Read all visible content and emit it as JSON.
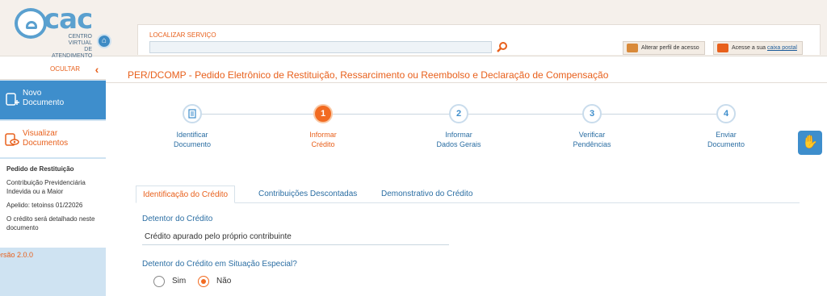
{
  "brand": {
    "name": "cac",
    "subtitle_line1": "CENTRO VIRTUAL",
    "subtitle_line2": "DE ATENDIMENTO"
  },
  "search": {
    "label": "LOCALIZAR SERVIÇO",
    "placeholder": "",
    "value": ""
  },
  "header_actions": {
    "alterar_perfil": "Alterar perfil de acesso",
    "acesse_prefix": "Acesse a sua ",
    "acesse_link": "caixa postal"
  },
  "sidebar": {
    "ocultar": "OCULTAR",
    "novo_line1": "Novo",
    "novo_line2": "Documento",
    "visualizar_line1": "Visualizar",
    "visualizar_line2": "Documentos",
    "info_title": "Pedido de Restituição",
    "info_desc": "Contribuição Previdenciária Indevida ou a Maior",
    "info_apelido": "Apelido: tetoinss 01/22026",
    "info_note": "O crédito será detalhado neste documento",
    "versao": "ersão 2.0.0"
  },
  "main": {
    "title": "PER/DCOMP - Pedido Eletrônico de Restituição, Ressarcimento ou Reembolso e Declaração de Compensação"
  },
  "steps": [
    {
      "number": "",
      "icon": "document-icon",
      "line1": "Identificar",
      "line2": "Documento",
      "active": false
    },
    {
      "number": "1",
      "line1": "Informar",
      "line2": "Crédito",
      "active": true
    },
    {
      "number": "2",
      "line1": "Informar",
      "line2": "Dados Gerais",
      "active": false
    },
    {
      "number": "3",
      "line1": "Verificar",
      "line2": "Pendências",
      "active": false
    },
    {
      "number": "4",
      "line1": "Enviar",
      "line2": "Documento",
      "active": false
    }
  ],
  "tabs": [
    {
      "label": "Identificação do Crédito",
      "active": true
    },
    {
      "label": "Contribuições Descontadas",
      "active": false
    },
    {
      "label": "Demonstrativo do Crédito",
      "active": false
    }
  ],
  "form": {
    "detentor_label": "Detentor do Crédito",
    "detentor_value": "Crédito apurado pelo próprio contribuinte",
    "situacao_label": "Detentor do Crédito em Situação Especial?",
    "option_sim": "Sim",
    "option_nao": "Não",
    "selected": "Não"
  },
  "colors": {
    "accent": "#e8601c",
    "primary": "#3e8ecc",
    "link": "#2b6ea3"
  }
}
